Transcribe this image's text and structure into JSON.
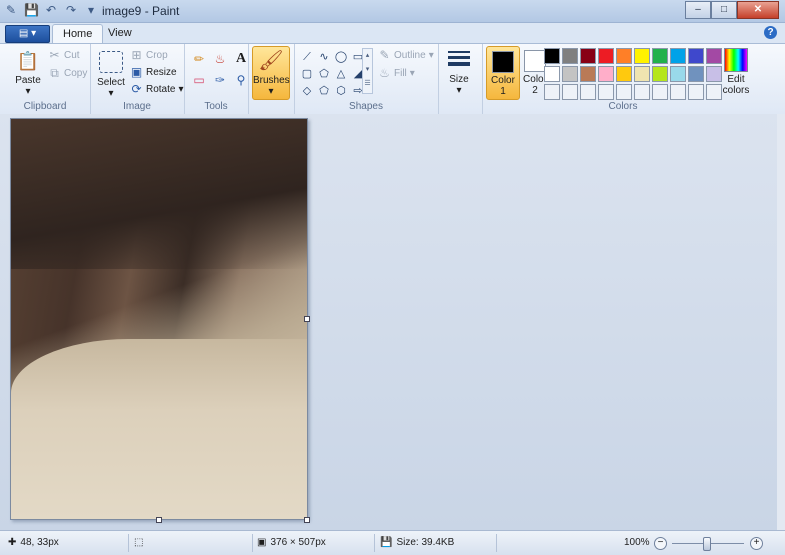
{
  "window": {
    "title": "image9 - Paint",
    "minimize": "–",
    "maximize": "□",
    "close": "✕"
  },
  "tabs": {
    "app_menu": "▤ ▾",
    "home": "Home",
    "view": "View",
    "help": "?"
  },
  "ribbon": {
    "clipboard": {
      "label": "Clipboard",
      "paste": "Paste",
      "cut": "Cut",
      "copy": "Copy"
    },
    "image": {
      "label": "Image",
      "select": "Select",
      "crop": "Crop",
      "resize": "Resize",
      "rotate": "Rotate"
    },
    "tools": {
      "label": "Tools"
    },
    "brushes": {
      "label": "Brushes"
    },
    "shapes": {
      "label": "Shapes",
      "outline": "Outline",
      "fill": "Fill"
    },
    "size": {
      "label": "Size"
    },
    "colors": {
      "label": "Colors",
      "color1": "Color 1",
      "color2": "Color 2",
      "edit": "Edit colors",
      "color1_value": "#000000",
      "color2_value": "#ffffff",
      "palette_row1": [
        "#000000",
        "#7f7f7f",
        "#880015",
        "#ed1c24",
        "#ff7f27",
        "#fff200",
        "#22b14c",
        "#00a2e8",
        "#3f48cc",
        "#a349a4"
      ],
      "palette_row2": [
        "#ffffff",
        "#c3c3c3",
        "#b97a57",
        "#ffaec9",
        "#ffc90e",
        "#efe4b0",
        "#b5e61d",
        "#99d9ea",
        "#7092be",
        "#c8bfe7"
      ]
    }
  },
  "status": {
    "cursor_pos": "48, 33px",
    "dimensions": "376 × 507px",
    "file_size": "Size: 39.4KB",
    "zoom": "100%",
    "zoom_out": "−",
    "zoom_in": "+"
  }
}
